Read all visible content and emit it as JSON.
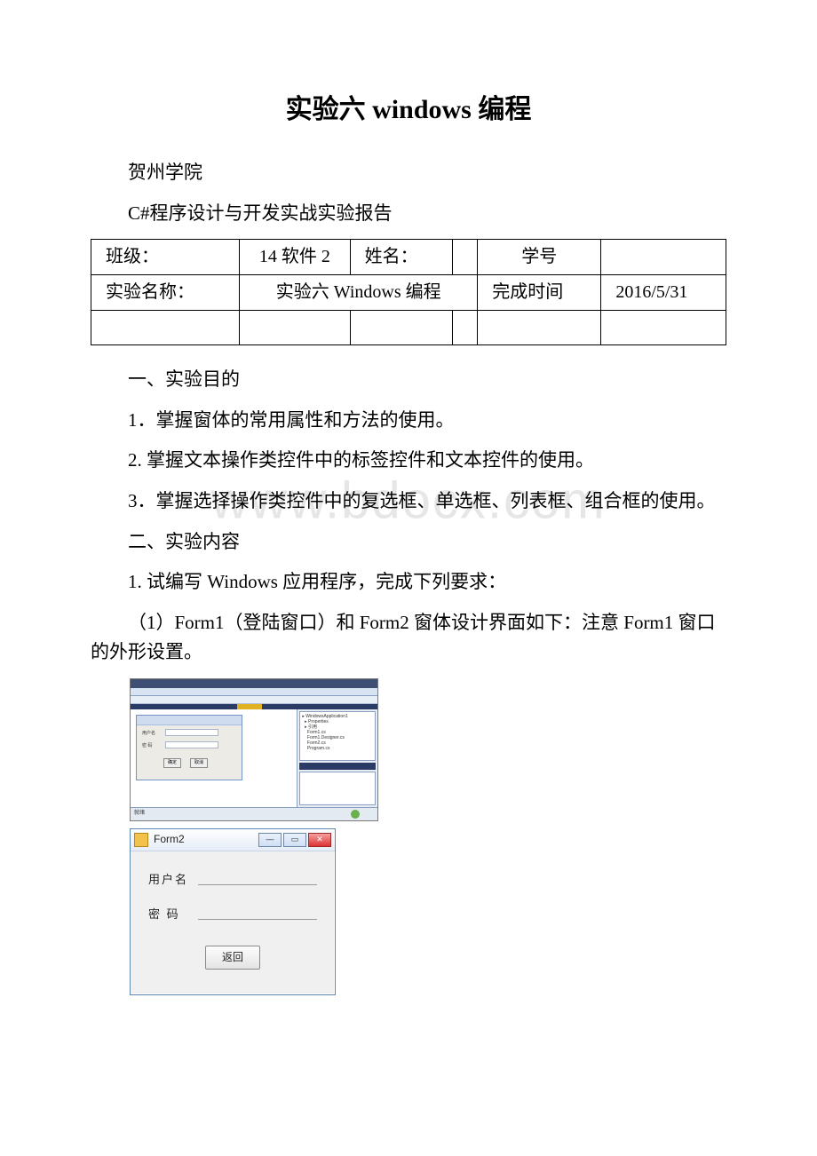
{
  "title": "实验六 windows 编程",
  "school": "贺州学院",
  "report_name": "C#程序设计与开发实战实验报告",
  "table": {
    "r1": {
      "c1": "班级：",
      "c2": "14 软件 2",
      "c3": "姓名：",
      "c4": "",
      "c5": "学号",
      "c6": ""
    },
    "r2": {
      "c1": "实验名称：",
      "c2": "实验六 Windows 编程",
      "c3": "完成时间",
      "c4": "2016/5/31"
    }
  },
  "section1_heading": "一、实验目的",
  "goals": {
    "g1": "1．掌握窗体的常用属性和方法的使用。",
    "g2": "2. 掌握文本操作类控件中的标签控件和文本控件的使用。",
    "g3": "3．掌握选择操作类控件中的复选框、单选框、列表框、组合框的使用。"
  },
  "section2_heading": "二、实验内容",
  "task_intro": "1. 试编写 Windows 应用程序，完成下列要求：",
  "task_sub1": "（1）Form1（登陆窗口）和 Form2 窗体设计界面如下：注意 Form1 窗口的外形设置。",
  "watermark": "www.bdocx.com",
  "ide": {
    "form1": {
      "label_user": "用户名",
      "label_pwd": "密  码",
      "btn_ok": "确定",
      "btn_cancel": "取消"
    },
    "solution": "▸ WindowsApplication1\n  ▸ Properties\n  ▸ 引用\n    Form1.cs\n    Form1.Designer.cs\n    Form2.cs\n    Program.cs",
    "status_text": "就绪"
  },
  "form2": {
    "title": "Form2",
    "label_user": "用户名",
    "label_pwd": "密  码",
    "btn_back": "返回",
    "win_min": "—",
    "win_max": "▭",
    "win_close": "✕"
  }
}
